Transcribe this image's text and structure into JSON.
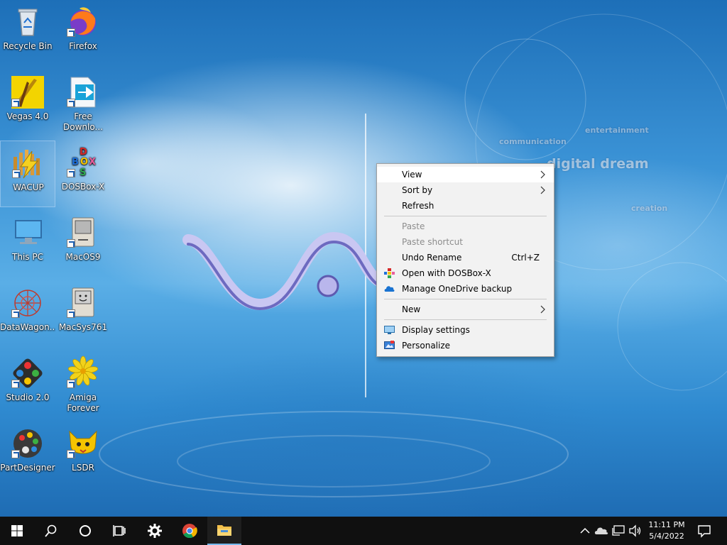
{
  "wallpaper": {
    "text_communication": "communication",
    "text_entertainment": "entertainment",
    "text_digital_dream": "digital dream",
    "text_creation": "creation"
  },
  "desktop_icons": [
    {
      "label": "Recycle Bin",
      "icon": "recycle-bin-icon"
    },
    {
      "label": "Firefox",
      "icon": "firefox-icon"
    },
    {
      "label": "Vegas 4.0",
      "icon": "vegas-icon"
    },
    {
      "label": "Free Downlo...",
      "icon": "free-download-icon"
    },
    {
      "label": "WACUP",
      "icon": "wacup-icon"
    },
    {
      "label": "DOSBox-X",
      "icon": "dosbox-icon"
    },
    {
      "label": "This PC",
      "icon": "this-pc-icon"
    },
    {
      "label": "MacOS9",
      "icon": "macos9-icon"
    },
    {
      "label": "DataWagon...",
      "icon": "datawagon-icon"
    },
    {
      "label": "MacSys761",
      "icon": "macsys-icon"
    },
    {
      "label": "Studio 2.0",
      "icon": "studio-icon"
    },
    {
      "label": "Amiga Forever",
      "icon": "amiga-icon"
    },
    {
      "label": "PartDesigner",
      "icon": "partdesigner-icon"
    },
    {
      "label": "LSDR",
      "icon": "lsdr-icon"
    }
  ],
  "context_menu": {
    "view": "View",
    "sort_by": "Sort by",
    "refresh": "Refresh",
    "paste": "Paste",
    "paste_shortcut": "Paste shortcut",
    "undo_rename": "Undo Rename",
    "undo_rename_shortcut": "Ctrl+Z",
    "open_with_dosbox": "Open with DOSBox-X",
    "manage_onedrive": "Manage OneDrive backup",
    "new": "New",
    "display_settings": "Display settings",
    "personalize": "Personalize",
    "submenu_arrow": ">"
  },
  "taskbar": {
    "time": "11:11 PM",
    "date": "5/4/2022"
  },
  "colors": {
    "taskbar_bg": "#101010",
    "menu_bg": "#f2f2f2",
    "active_indicator": "#76b9ed"
  }
}
